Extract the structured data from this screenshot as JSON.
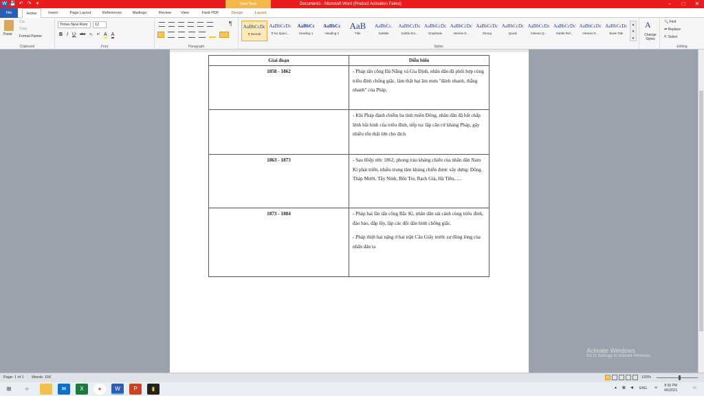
{
  "window": {
    "title": "Document1 - Microsoft Word (Product Activation Failed)",
    "tool_tab": "Table Tools",
    "controls": [
      "–",
      "□",
      "✕"
    ]
  },
  "qat": [
    "W",
    "💾",
    "↶",
    "↷",
    "▾"
  ],
  "tabs": [
    "File",
    "Home",
    "Insert",
    "Page Layout",
    "References",
    "Mailings",
    "Review",
    "View",
    "Foxit PDF",
    "Design",
    "Layout"
  ],
  "ribbon": {
    "clipboard": {
      "paste": "Paste",
      "cut": "Cut",
      "copy": "Copy",
      "format_painter": "Format Painter",
      "label": "Clipboard"
    },
    "font": {
      "name": "Times New Rom",
      "size": "12",
      "label": "Font",
      "buttons": [
        "B",
        "I",
        "U",
        "abe",
        "x₂",
        "x²",
        "A",
        "A"
      ]
    },
    "paragraph": {
      "label": "Paragraph",
      "pilcrow": "¶"
    },
    "styles": {
      "label": "Styles",
      "items": [
        {
          "preview": "AaBbCcDc",
          "name": "¶ Normal"
        },
        {
          "preview": "AaBbCcDc",
          "name": "¶ No Spaci..."
        },
        {
          "preview": "AaBbCc",
          "name": "Heading 1"
        },
        {
          "preview": "AaBbCc",
          "name": "Heading 2"
        },
        {
          "preview": "AaB",
          "name": "Title"
        },
        {
          "preview": "AaBbCc.",
          "name": "Subtitle"
        },
        {
          "preview": "AaBbCcDc",
          "name": "Subtle Em..."
        },
        {
          "preview": "AaBbCcDc",
          "name": "Emphasis"
        },
        {
          "preview": "AaBbCcDc",
          "name": "Intense E..."
        },
        {
          "preview": "AaBbCcDc",
          "name": "Strong"
        },
        {
          "preview": "AaBbCcDc",
          "name": "Quote"
        },
        {
          "preview": "AaBbCcDc",
          "name": "Intense Q..."
        },
        {
          "preview": "AaBbCcDc",
          "name": "Subtle Ref..."
        },
        {
          "preview": "AaBbCcDc",
          "name": "Intense R..."
        },
        {
          "preview": "AaBbCcDc",
          "name": "Book Title"
        }
      ],
      "change_styles": "Change Styles"
    },
    "editing": {
      "find": "Find",
      "replace": "Replace",
      "select": "Select",
      "label": "Editing"
    }
  },
  "table": {
    "headers": [
      "Giai đoạn",
      "Diễn biến"
    ],
    "rows": [
      {
        "period": "1858 - 1862",
        "events": [
          "- Pháp tấn công Đà Nẵng và Gia Định, nhân dân đã phối hợp cùng triều đình chống giặc, làm thất bại âm mưu \"đánh nhanh, thắng nhanh\" của Pháp."
        ]
      },
      {
        "period": "",
        "events": [
          "- Khi Pháp đánh chiếm ba tỉnh miền Đông, nhân dân đã bất chấp lệnh bãi binh của triều đình, tiếp tục lập căn cứ kháng Pháp, gây nhiều tổn thất lớn cho địch"
        ]
      },
      {
        "period": "1863 - 1873",
        "events": [
          "- Sau Hiệp ước 1862, phong trào kháng chiến của nhân dân Nam Kì phát triển, nhiều trung tâm kháng chiến được xây dựng: Đồng Tháp Mười, Tây Ninh, Bến Tre, Rạch Giá, Hà Tiên,…."
        ]
      },
      {
        "period": "1873 - 1884",
        "events": [
          "- Pháp hai lần tấn công Bắc Kì, nhân dân sát cánh cùng triều đình, đào hào, đắp lũy, lập các đội dân binh chống giặc.",
          "- Pháp thiệt hại nặng ở hai trận Cầu Giấy trước sự đồng lòng của nhân dân ta"
        ]
      }
    ]
  },
  "watermark": {
    "line1": "Activate Windows",
    "line2": "Go to Settings to activate Windows."
  },
  "status": {
    "page": "Page: 1 of 1",
    "words": "Words: 156",
    "zoom": "120%"
  },
  "taskbar": {
    "time": "8:36 PM",
    "date": "4/6/2021",
    "lang": "ENG",
    "icons": [
      "windows-start-icon",
      "search-icon",
      "file-explorer-icon",
      "store-icon",
      "mail-icon",
      "excel-icon",
      "chrome-icon",
      "word-icon",
      "powerpoint-icon",
      "sticky-notes-icon"
    ]
  }
}
